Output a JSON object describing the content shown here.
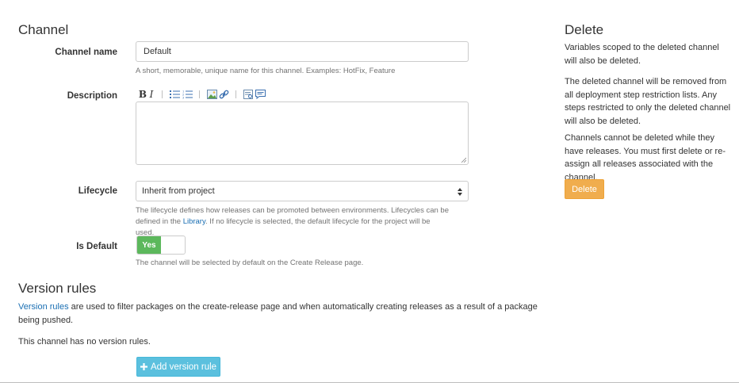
{
  "channel": {
    "heading": "Channel",
    "name": {
      "label": "Channel name",
      "value": "Default",
      "help": "A short, memorable, unique name for this channel. Examples: HotFix, Feature"
    },
    "description": {
      "label": "Description",
      "toolbar": {
        "bold": "B",
        "italic": "I",
        "icons": [
          "bullet-list-icon",
          "numbered-list-icon",
          "image-icon",
          "link-icon",
          "preview-icon",
          "help-comment-icon"
        ]
      },
      "value": ""
    },
    "lifecycle": {
      "label": "Lifecycle",
      "selected": "Inherit from project",
      "help_before": "The lifecycle defines how releases can be promoted between environments. Lifecycles can be defined in the ",
      "help_link": "Library",
      "help_after": ". If no lifecycle is selected, the default lifecycle for the project will be used."
    },
    "is_default": {
      "label": "Is Default",
      "toggle_on": "Yes",
      "state": true,
      "help": "The channel will be selected by default on the Create Release page."
    }
  },
  "version_rules": {
    "heading": "Version rules",
    "intro_link": "Version rules",
    "intro_text": " are used to filter packages on the create-release page and when automatically creating releases as a result of a package being pushed.",
    "empty_text": "This channel has no version rules.",
    "add_button": "Add version rule",
    "add_icon": "plus-icon"
  },
  "delete_panel": {
    "heading": "Delete",
    "para1": "Variables scoped to the deleted channel will also be deleted.",
    "para2": "The deleted channel will be removed from all deployment step restriction lists. Any steps restricted to only the deleted channel will also be deleted.",
    "para3": "Channels cannot be deleted while they have releases. You must first delete or re-assign all releases associated with the channel.",
    "button": "Delete"
  },
  "colors": {
    "link": "#1a6fb3",
    "toggle_on": "#5cb85c",
    "add_button": "#5bc0de",
    "delete_button": "#f0ad4e"
  }
}
